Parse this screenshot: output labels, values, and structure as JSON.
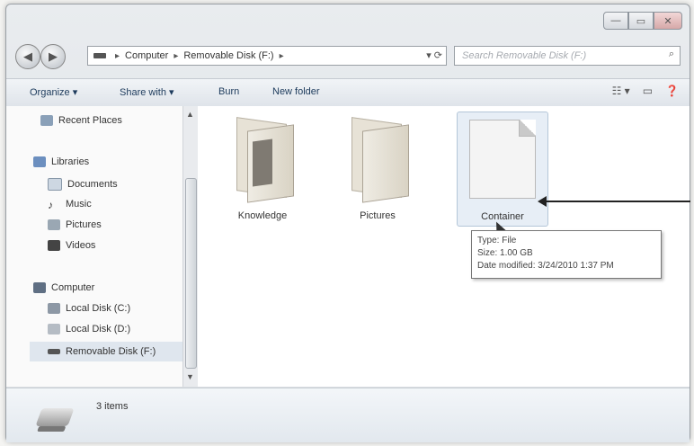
{
  "window": {
    "controls": [
      "—",
      "▭",
      "✕"
    ]
  },
  "navigation": {
    "back_icon": "◀",
    "forward_icon": "▶",
    "breadcrumb": [
      "Computer",
      "Removable Disk (F:)"
    ],
    "search_placeholder": "Search Removable Disk (F:)"
  },
  "toolbar": {
    "organize": "Organize ▾",
    "share_with": "Share with ▾",
    "burn": "Burn",
    "new_folder": "New folder"
  },
  "sidebar": {
    "recent_places": "Recent Places",
    "libraries": "Libraries",
    "library_items": [
      "Documents",
      "Music",
      "Pictures",
      "Videos"
    ],
    "computer": "Computer",
    "drives": [
      "Local Disk (C:)",
      "Local Disk (D:)",
      "Removable Disk (F:)"
    ]
  },
  "files": [
    {
      "name": "Knowledge",
      "type": "folder"
    },
    {
      "name": "Pictures",
      "type": "folder"
    },
    {
      "name": "Container",
      "type": "file"
    }
  ],
  "tooltip": {
    "type_line": "Type: File",
    "size_line": "Size: 1.00 GB",
    "date_line": "Date modified: 3/24/2010 1:37 PM"
  },
  "details": {
    "items_count": "3 items"
  }
}
